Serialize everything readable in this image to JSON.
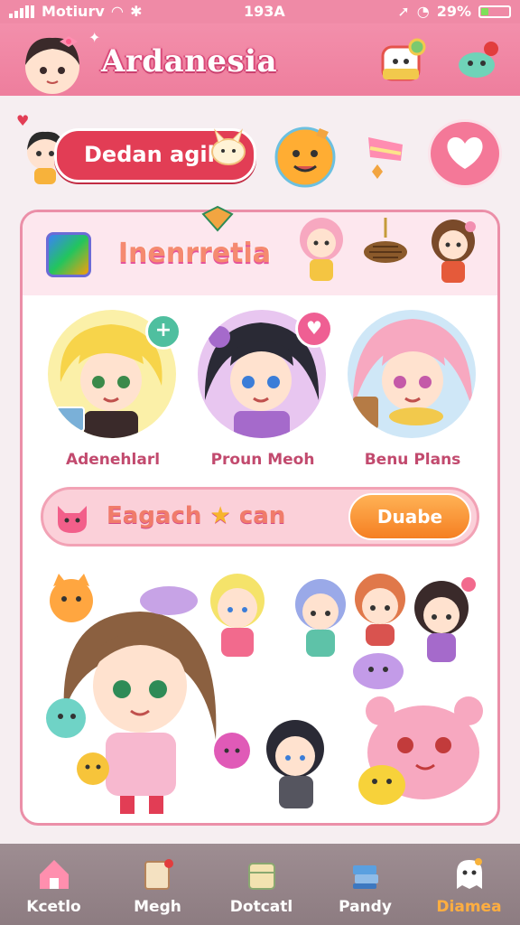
{
  "status_bar": {
    "carrier": "Motiurv",
    "time": "193A",
    "battery": "29%"
  },
  "header": {
    "title": "Ardanesia"
  },
  "promo": {
    "label": "Dedan agih"
  },
  "card": {
    "title": "Inenrretia",
    "characters": [
      {
        "name": "Adenehlarl"
      },
      {
        "name": "Proun Meoh"
      },
      {
        "name": "Benu Plans"
      }
    ],
    "search": {
      "text": "Eagach",
      "text2": "can",
      "button": "Duabe"
    }
  },
  "nav": {
    "items": [
      {
        "label": "Kcetlo",
        "icon": "house-icon"
      },
      {
        "label": "Megh",
        "icon": "book-icon"
      },
      {
        "label": "Dotcatl",
        "icon": "box-icon"
      },
      {
        "label": "Pandy",
        "icon": "books-icon"
      },
      {
        "label": "Diamea",
        "icon": "ghost-icon"
      }
    ],
    "active_index": 4
  },
  "colors": {
    "header": "#ef8aa6",
    "promo": "#e23d55",
    "accent": "#f57f22",
    "card_border": "#eb8fa8"
  }
}
